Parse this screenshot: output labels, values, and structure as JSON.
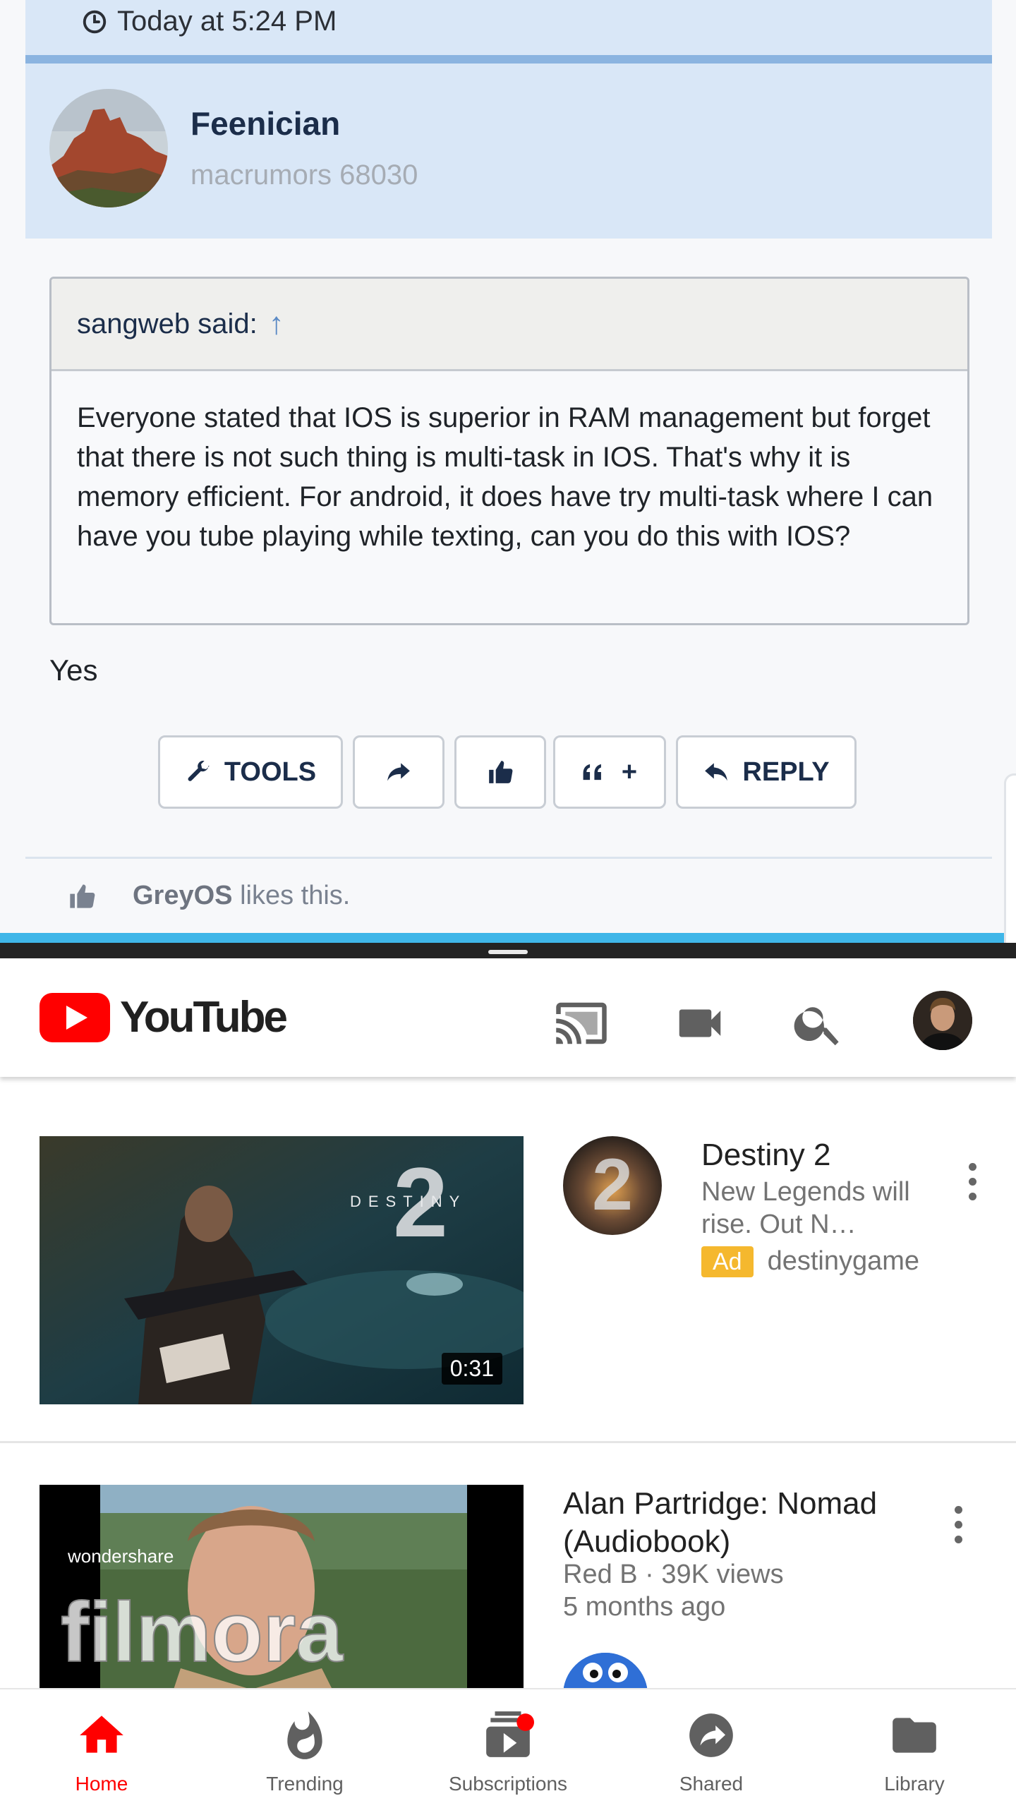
{
  "forum": {
    "timestamp": "Today at 5:24 PM",
    "author": {
      "name": "Feenician",
      "rank": "macrumors 68030"
    },
    "quote": {
      "attribution": "sangweb said:",
      "arrow": "↑",
      "body": "Everyone stated that IOS is superior in RAM management but forget that there is not such thing is multi-task in IOS. That's why it is memory efficient. For android, it does have try multi-task where I can have you tube playing while texting, can you do this with IOS?"
    },
    "reply": "Yes",
    "buttons": {
      "tools": "TOOLS",
      "multiquote": "+",
      "reply": "REPLY"
    },
    "likes": {
      "user": "GreyOS",
      "text": " likes this."
    }
  },
  "youtube": {
    "logo_text": "YouTube",
    "header_icons": [
      "cast-icon",
      "video-camera-icon",
      "search-icon",
      "account-avatar"
    ],
    "videos": [
      {
        "title": "Destiny 2",
        "description": "New Legends will rise. Out N…",
        "ad_label": "Ad",
        "channel": "destinygame",
        "duration": "0:31",
        "thumb_text": "DESTINY",
        "thumb_number": "2"
      },
      {
        "title": "Alan Partridge: Nomad (Audiobook)",
        "meta": "Red B · 39K views",
        "age": "5 months ago",
        "watermark_brand": "wondershare",
        "watermark_product": "filmora"
      }
    ],
    "nav": [
      {
        "label": "Home",
        "icon": "home-icon",
        "active": true
      },
      {
        "label": "Trending",
        "icon": "flame-icon",
        "active": false
      },
      {
        "label": "Subscriptions",
        "icon": "subscriptions-icon",
        "active": false
      },
      {
        "label": "Shared",
        "icon": "share-icon",
        "active": false
      },
      {
        "label": "Library",
        "icon": "folder-icon",
        "active": false
      }
    ],
    "colors": {
      "brand_red": "#ff0000",
      "ad_yellow": "#f5b82e"
    }
  }
}
